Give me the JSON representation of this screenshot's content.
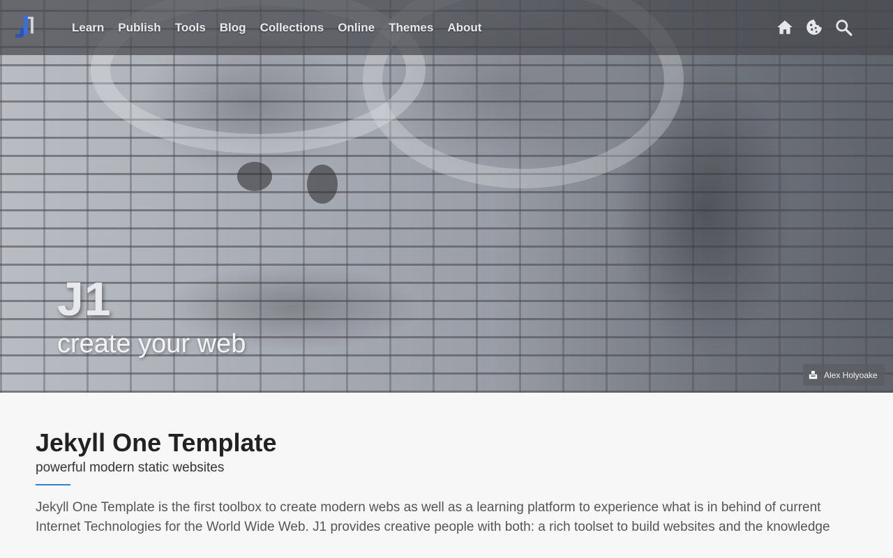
{
  "navbar": {
    "links": [
      "Learn",
      "Publish",
      "Tools",
      "Blog",
      "Collections",
      "Online",
      "Themes",
      "About"
    ],
    "icons": [
      "home-icon",
      "cookie-icon",
      "search-icon"
    ]
  },
  "hero": {
    "title": "J1",
    "tagline": "create your web",
    "credit": "Alex Holyoake"
  },
  "content": {
    "title": "Jekyll One Template",
    "subtitle": "powerful modern static websites",
    "lead": "Jekyll One Template is the first toolbox to create modern webs as well as a learning platform to experience what is in behind of current Internet Technologies for the World Wide Web. J1 provides creative people with both: a rich toolset to build websites and the knowledge"
  },
  "colors": {
    "accent": "#2f80d1",
    "navbar_bg": "#46484e"
  }
}
